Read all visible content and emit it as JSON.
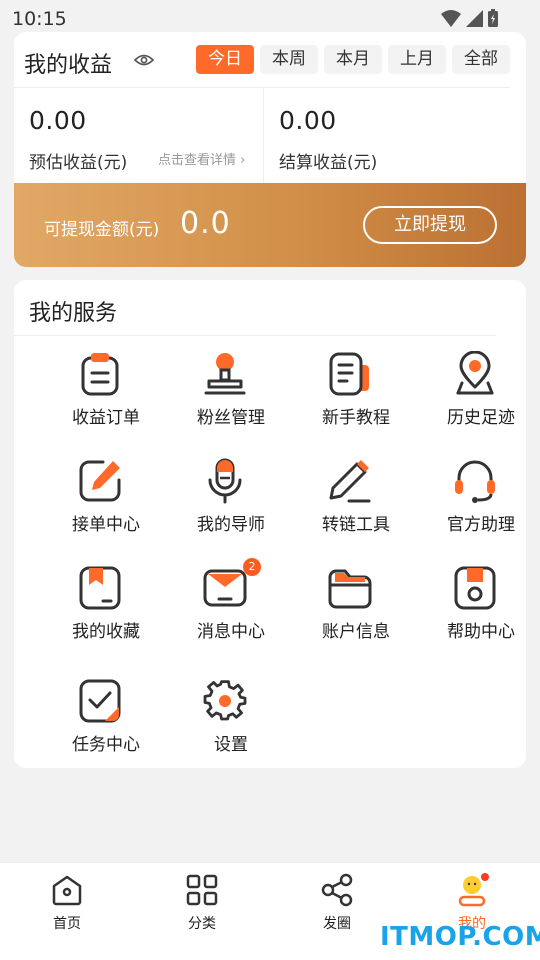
{
  "status_bar": {
    "time": "10:15",
    "icons": [
      "wifi-icon",
      "signal-icon",
      "battery-icon"
    ]
  },
  "earnings": {
    "title": "我的收益",
    "tabs": [
      {
        "label": "今日",
        "active": true
      },
      {
        "label": "本周",
        "active": false
      },
      {
        "label": "本月",
        "active": false
      },
      {
        "label": "上月",
        "active": false
      },
      {
        "label": "全部",
        "active": false
      }
    ],
    "estimated": {
      "value": "0.00",
      "label": "预估收益(元)"
    },
    "settled": {
      "value": "0.00",
      "label": "结算收益(元)"
    },
    "detail_link": "点击查看详情",
    "withdrawable_label": "可提现金额(元)",
    "withdrawable_amount": "0.0",
    "withdraw_button": "立即提现"
  },
  "services": {
    "title": "我的服务",
    "items": [
      {
        "label": "收益订单",
        "icon": "clipboard-icon"
      },
      {
        "label": "粉丝管理",
        "icon": "fans-icon"
      },
      {
        "label": "新手教程",
        "icon": "tutorial-icon"
      },
      {
        "label": "历史足迹",
        "icon": "location-pin-icon"
      },
      {
        "label": "接单中心",
        "icon": "edit-icon"
      },
      {
        "label": "我的导师",
        "icon": "microphone-icon"
      },
      {
        "label": "转链工具",
        "icon": "pencil-icon"
      },
      {
        "label": "官方助理",
        "icon": "headset-icon"
      },
      {
        "label": "我的收藏",
        "icon": "bookmark-icon"
      },
      {
        "label": "消息中心",
        "icon": "message-icon",
        "badge": "2"
      },
      {
        "label": "账户信息",
        "icon": "folder-icon"
      },
      {
        "label": "帮助中心",
        "icon": "help-icon"
      },
      {
        "label": "任务中心",
        "icon": "task-check-icon"
      },
      {
        "label": "设置",
        "icon": "gear-icon"
      }
    ]
  },
  "bottom_nav": [
    {
      "label": "首页",
      "icon": "home-icon",
      "active": false
    },
    {
      "label": "分类",
      "icon": "category-grid-icon",
      "active": false
    },
    {
      "label": "发圈",
      "icon": "share-icon",
      "active": false
    },
    {
      "label": "我的",
      "icon": "profile-icon",
      "active": true
    }
  ],
  "colors": {
    "accent": "#ff6a2b",
    "gold_start": "#e2a866",
    "gold_end": "#bb7032",
    "outline": "#333333"
  },
  "watermark": "ITMOP.COM"
}
